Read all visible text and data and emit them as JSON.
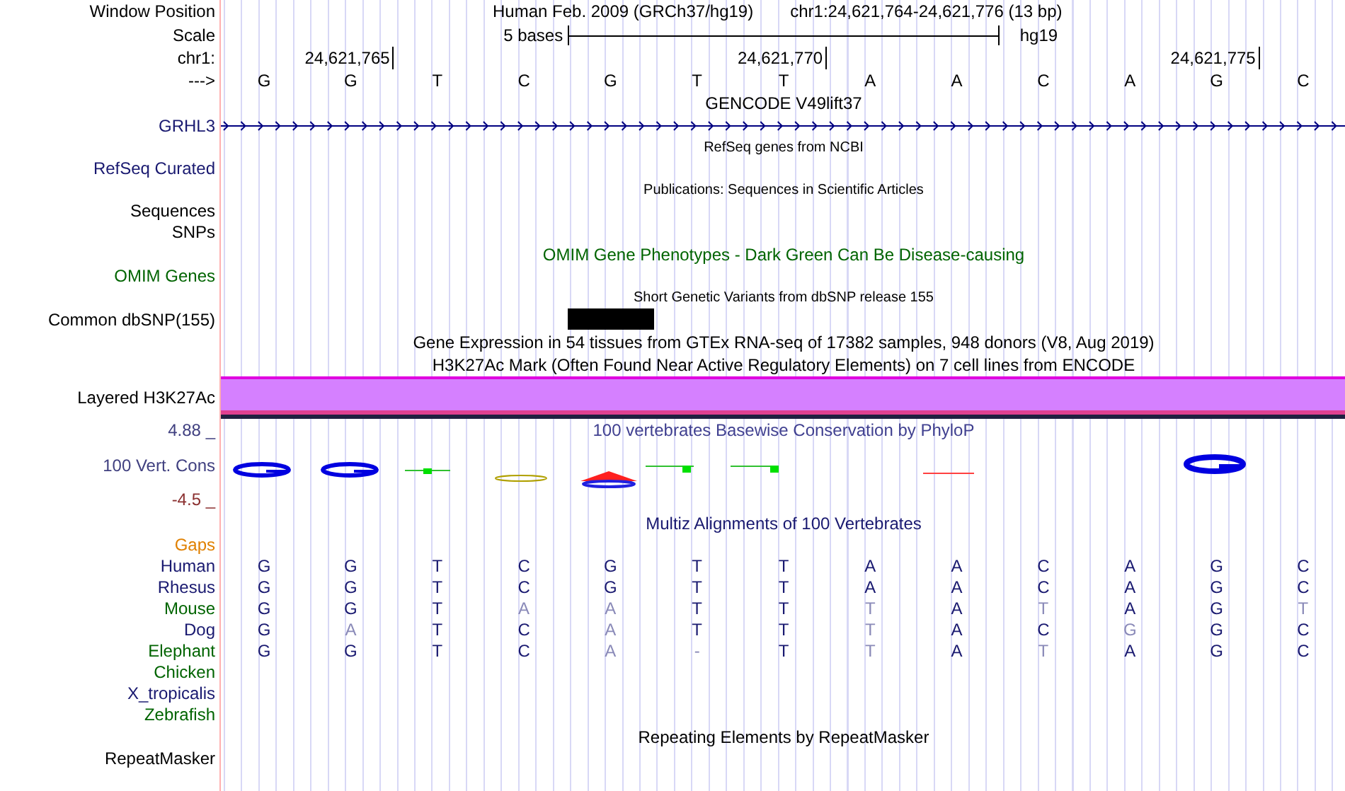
{
  "rows": [
    {
      "kind": "header",
      "label": "Window Position",
      "assembly": "Human Feb. 2009 (GRCh37/hg19)",
      "position": "chr1:24,621,764-24,621,776 (13 bp)"
    },
    {
      "kind": "scale",
      "label": "Scale",
      "length": "5 bases",
      "assembly": "hg19"
    },
    {
      "kind": "ruler",
      "label": "chr1:",
      "ticks": [
        "24,621,765",
        "24,621,770",
        "24,621,775"
      ]
    },
    {
      "kind": "bases",
      "label": "--->",
      "bases": [
        "G",
        "G",
        "T",
        "C",
        "G",
        "T",
        "T",
        "A",
        "A",
        "C",
        "A",
        "G",
        "C"
      ]
    },
    {
      "kind": "title",
      "title": "GENCODE V49lift37",
      "color": "#000000"
    },
    {
      "kind": "gene",
      "label": "GRHL3",
      "color": "#191970"
    },
    {
      "kind": "caption",
      "title": "RefSeq genes from NCBI"
    },
    {
      "kind": "empty",
      "label": "RefSeq Curated",
      "color": "#191970"
    },
    {
      "kind": "caption",
      "title": "Publications: Sequences in Scientific Articles"
    },
    {
      "kind": "empty",
      "label": "Sequences",
      "color": "#000000"
    },
    {
      "kind": "empty",
      "label": "SNPs",
      "color": "#000000"
    },
    {
      "kind": "title",
      "title": "OMIM Gene Phenotypes - Dark Green Can Be Disease-causing",
      "color": "#006400"
    },
    {
      "kind": "empty",
      "label": "OMIM Genes",
      "color": "#006400"
    },
    {
      "kind": "caption",
      "title": "Short Genetic Variants from dbSNP release 155"
    },
    {
      "kind": "snp",
      "label": "Common dbSNP(155)",
      "color": "#000000"
    },
    {
      "kind": "title",
      "title": "Gene Expression in 54 tissues from GTEx RNA-seq of 17382 samples, 948 donors (V8, Aug 2019)",
      "color": "#000000"
    },
    {
      "kind": "title",
      "title": "H3K27Ac Mark (Often Found Near Active Regulatory Elements) on 7 cell lines from ENCODE",
      "color": "#000000"
    },
    {
      "kind": "layered",
      "label": "Layered H3K27Ac",
      "color": "#000000"
    },
    {
      "kind": "axis",
      "label": "4.88 _",
      "color": "#404080",
      "title": "100 vertebrates Basewise Conservation by PhyloP"
    },
    {
      "kind": "logo",
      "label": "100 Vert. Cons",
      "color": "#404080"
    },
    {
      "kind": "axis",
      "label": "-4.5 _",
      "color": "#8b3030"
    },
    {
      "kind": "title",
      "title": "Multiz Alignments of 100 Vertebrates",
      "color": "#191970"
    },
    {
      "kind": "empty",
      "label": "Gaps",
      "color": "#e08000"
    },
    {
      "kind": "alignment",
      "label": "Human",
      "color": "#191970",
      "bases": [
        {
          "base": "G",
          "match": true
        },
        {
          "base": "G",
          "match": true
        },
        {
          "base": "T",
          "match": true
        },
        {
          "base": "C",
          "match": true
        },
        {
          "base": "G",
          "match": true
        },
        {
          "base": "T",
          "match": true
        },
        {
          "base": "T",
          "match": true
        },
        {
          "base": "A",
          "match": true
        },
        {
          "base": "A",
          "match": true
        },
        {
          "base": "C",
          "match": true
        },
        {
          "base": "A",
          "match": true
        },
        {
          "base": "G",
          "match": true
        },
        {
          "base": "C",
          "match": true
        }
      ]
    },
    {
      "kind": "alignment",
      "label": "Rhesus",
      "color": "#191970",
      "bases": [
        {
          "base": "G",
          "match": true
        },
        {
          "base": "G",
          "match": true
        },
        {
          "base": "T",
          "match": true
        },
        {
          "base": "C",
          "match": true
        },
        {
          "base": "G",
          "match": true
        },
        {
          "base": "T",
          "match": true
        },
        {
          "base": "T",
          "match": true
        },
        {
          "base": "A",
          "match": true
        },
        {
          "base": "A",
          "match": true
        },
        {
          "base": "C",
          "match": true
        },
        {
          "base": "A",
          "match": true
        },
        {
          "base": "G",
          "match": true
        },
        {
          "base": "C",
          "match": true
        }
      ]
    },
    {
      "kind": "alignment",
      "label": "Mouse",
      "color": "#006400",
      "bases": [
        {
          "base": "G",
          "match": true
        },
        {
          "base": "G",
          "match": true
        },
        {
          "base": "T",
          "match": true
        },
        {
          "base": "A",
          "match": false
        },
        {
          "base": "A",
          "match": false
        },
        {
          "base": "T",
          "match": true
        },
        {
          "base": "T",
          "match": true
        },
        {
          "base": "T",
          "match": false
        },
        {
          "base": "A",
          "match": true
        },
        {
          "base": "T",
          "match": false
        },
        {
          "base": "A",
          "match": true
        },
        {
          "base": "G",
          "match": true
        },
        {
          "base": "T",
          "match": false
        }
      ]
    },
    {
      "kind": "alignment",
      "label": "Dog",
      "color": "#191970",
      "bases": [
        {
          "base": "G",
          "match": true
        },
        {
          "base": "A",
          "match": false
        },
        {
          "base": "T",
          "match": true
        },
        {
          "base": "C",
          "match": true
        },
        {
          "base": "A",
          "match": false
        },
        {
          "base": "T",
          "match": true
        },
        {
          "base": "T",
          "match": true
        },
        {
          "base": "T",
          "match": false
        },
        {
          "base": "A",
          "match": true
        },
        {
          "base": "C",
          "match": true
        },
        {
          "base": "G",
          "match": false
        },
        {
          "base": "G",
          "match": true
        },
        {
          "base": "C",
          "match": true
        }
      ]
    },
    {
      "kind": "alignment",
      "label": "Elephant",
      "color": "#006400",
      "bases": [
        {
          "base": "G",
          "match": true
        },
        {
          "base": "G",
          "match": true
        },
        {
          "base": "T",
          "match": true
        },
        {
          "base": "C",
          "match": true
        },
        {
          "base": "A",
          "match": false
        },
        {
          "base": "-",
          "match": false
        },
        {
          "base": "T",
          "match": true
        },
        {
          "base": "T",
          "match": false
        },
        {
          "base": "A",
          "match": true
        },
        {
          "base": "T",
          "match": false
        },
        {
          "base": "A",
          "match": true
        },
        {
          "base": "G",
          "match": true
        },
        {
          "base": "C",
          "match": true
        }
      ]
    },
    {
      "kind": "empty",
      "label": "Chicken",
      "color": "#006400"
    },
    {
      "kind": "empty",
      "label": "X_tropicalis",
      "color": "#191970"
    },
    {
      "kind": "empty",
      "label": "Zebrafish",
      "color": "#006400"
    },
    {
      "kind": "title",
      "title": "Repeating Elements by RepeatMasker",
      "color": "#000000"
    },
    {
      "kind": "empty",
      "label": "RepeatMasker",
      "color": "#000000"
    }
  ]
}
